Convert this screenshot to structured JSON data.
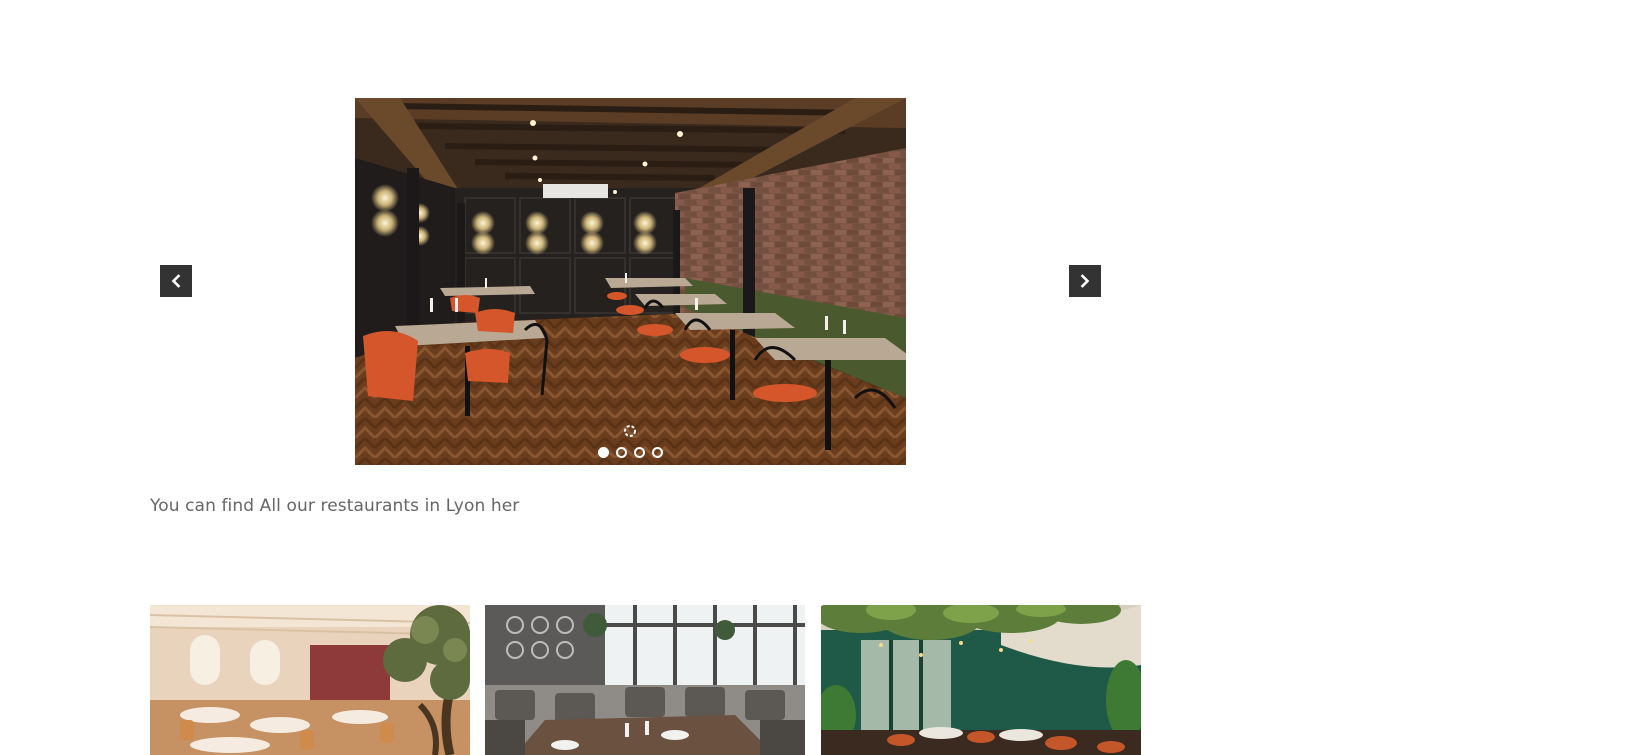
{
  "slider": {
    "image_alt": "Restaurant dining room with brick wall, wooden beams and orange chairs",
    "prev_icon": "chevron-left-icon",
    "next_icon": "chevron-right-icon",
    "slide_count": 4,
    "active_slide": 1,
    "loading_icon": "loading-spinner-icon"
  },
  "caption": {
    "text": "You can find All our restaurants in Lyon her"
  },
  "gallery": {
    "items": [
      {
        "alt": "Bright restaurant with olive tree and warm seating"
      },
      {
        "alt": "Modern restaurant with grey chairs and large windows"
      },
      {
        "alt": "Green-walled restaurant with hanging plants and orange chairs"
      }
    ]
  },
  "colors": {
    "nav_button_bg": "#333333",
    "caption_text": "#666666",
    "dot": "#ffffff"
  }
}
